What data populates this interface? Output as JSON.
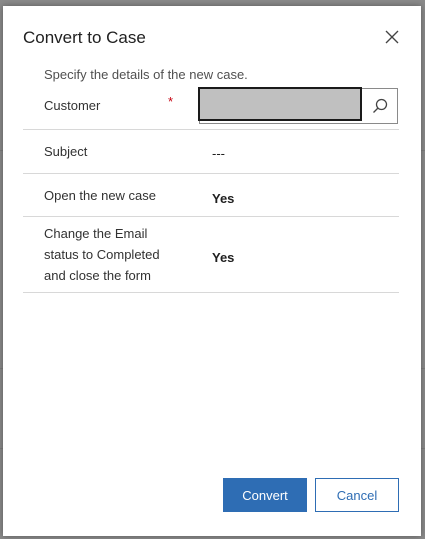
{
  "dialog": {
    "title": "Convert to Case",
    "description": "Specify the details of the new case.",
    "close_icon": "close-icon"
  },
  "fields": {
    "customer": {
      "label": "Customer",
      "required_marker": "*",
      "value": "",
      "search_icon": "search-icon"
    },
    "subject": {
      "label": "Subject",
      "value": "---"
    },
    "open_case": {
      "label": "Open the new case",
      "value": "Yes"
    },
    "change_status": {
      "label_line1": "Change the Email",
      "label_line2": "status to Completed",
      "label_line3": "and close the form",
      "value": "Yes"
    }
  },
  "footer": {
    "convert_label": "Convert",
    "cancel_label": "Cancel"
  },
  "colors": {
    "accent": "#2e6db4",
    "required": "#c5000f",
    "overlay": "#8a8a8a"
  }
}
